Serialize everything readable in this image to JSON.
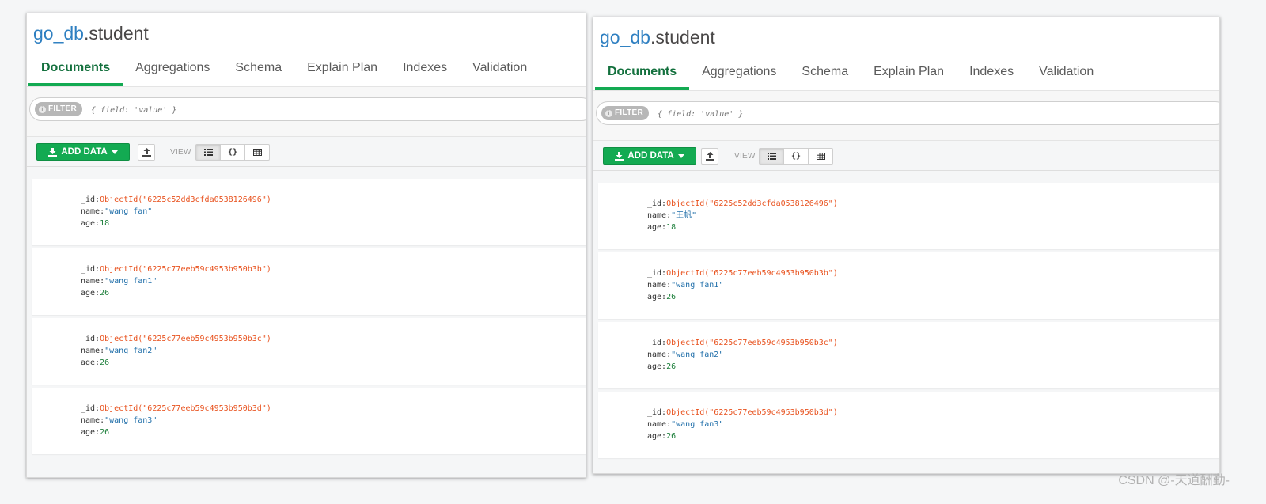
{
  "namespace": {
    "db": "go_db",
    "collection": ".student"
  },
  "tabs": [
    "Documents",
    "Aggregations",
    "Schema",
    "Explain Plan",
    "Indexes",
    "Validation"
  ],
  "active_tab": "Documents",
  "filter": {
    "badge": "FILTER",
    "placeholder": "{ field: 'value' }"
  },
  "toolbar": {
    "add_data": "ADD DATA",
    "view_label": "VIEW",
    "view_modes": [
      "list",
      "json",
      "table"
    ]
  },
  "panels": [
    {
      "documents": [
        {
          "id_key": "_id:",
          "id": "ObjectId(\"6225c52dd3cfda0538126496\")",
          "name_key": "name:",
          "name": "\"wang fan\"",
          "age_key": "age:",
          "age": "18"
        },
        {
          "id_key": "_id:",
          "id": "ObjectId(\"6225c77eeb59c4953b950b3b\")",
          "name_key": "name:",
          "name": "\"wang fan1\"",
          "age_key": "age:",
          "age": "26"
        },
        {
          "id_key": "_id:",
          "id": "ObjectId(\"6225c77eeb59c4953b950b3c\")",
          "name_key": "name:",
          "name": "\"wang fan2\"",
          "age_key": "age:",
          "age": "26"
        },
        {
          "id_key": "_id:",
          "id": "ObjectId(\"6225c77eeb59c4953b950b3d\")",
          "name_key": "name:",
          "name": "\"wang fan3\"",
          "age_key": "age:",
          "age": "26"
        }
      ]
    },
    {
      "documents": [
        {
          "id_key": "_id:",
          "id": "ObjectId(\"6225c52dd3cfda0538126496\")",
          "name_key": "name:",
          "name": "\"王帆\"",
          "age_key": "age:",
          "age": "18"
        },
        {
          "id_key": "_id:",
          "id": "ObjectId(\"6225c77eeb59c4953b950b3b\")",
          "name_key": "name:",
          "name": "\"wang fan1\"",
          "age_key": "age:",
          "age": "26"
        },
        {
          "id_key": "_id:",
          "id": "ObjectId(\"6225c77eeb59c4953b950b3c\")",
          "name_key": "name:",
          "name": "\"wang fan2\"",
          "age_key": "age:",
          "age": "26"
        },
        {
          "id_key": "_id:",
          "id": "ObjectId(\"6225c77eeb59c4953b950b3d\")",
          "name_key": "name:",
          "name": "\"wang fan3\"",
          "age_key": "age:",
          "age": "26"
        }
      ]
    }
  ],
  "watermark": "CSDN @-天道酬勤-",
  "colors": {
    "accent": "#13aa52",
    "db_link": "#2e7fc1",
    "objectid": "#e8511d",
    "string": "#1f6ea9",
    "number": "#1d7f3b"
  },
  "icons": {
    "add_data": "download-icon",
    "caret": "caret-down-icon",
    "import": "upload-icon",
    "list_view": "list-icon",
    "json_view": "braces-icon",
    "table_view": "table-icon"
  }
}
